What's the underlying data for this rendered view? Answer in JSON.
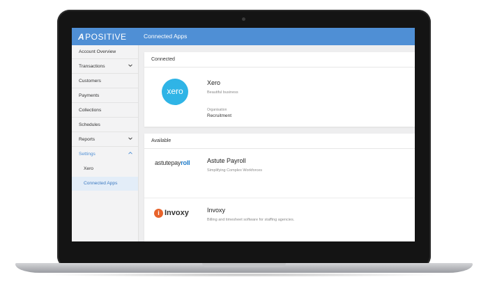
{
  "app": {
    "logo_text": "POSITIVE",
    "logo_mark": "A",
    "page_title": "Connected Apps"
  },
  "sidebar": {
    "items": [
      {
        "label": "Account Overview",
        "chevron": ""
      },
      {
        "label": "Transactions",
        "chevron": "chevron-down-icon"
      },
      {
        "label": "Customers",
        "chevron": ""
      },
      {
        "label": "Payments",
        "chevron": ""
      },
      {
        "label": "Collections",
        "chevron": ""
      },
      {
        "label": "Schedules",
        "chevron": ""
      },
      {
        "label": "Reports",
        "chevron": "chevron-down-icon"
      },
      {
        "label": "Settings",
        "chevron": "chevron-up-icon"
      },
      {
        "label": "Xero",
        "chevron": ""
      },
      {
        "label": "Connected Apps",
        "chevron": ""
      }
    ]
  },
  "connected": {
    "header": "Connected",
    "apps": [
      {
        "name": "Xero",
        "logo_text": "xero",
        "description": "Beautiful business",
        "organisation_label": "Organisation",
        "organisation_value": "Recruitment"
      }
    ]
  },
  "available": {
    "header": "Available",
    "apps": [
      {
        "name": "Astute Payroll",
        "logo_text_a": "astutepay",
        "logo_text_b": "roll",
        "description": "Simplifying Complex Workforces"
      },
      {
        "name": "Invoxy",
        "logo_mark": "i",
        "logo_text": "Invoxy",
        "description": "Billing and timesheet software for staffing agencies."
      }
    ]
  },
  "colors": {
    "brand": "#4f8fd5",
    "xero": "#2fb4e6",
    "invoxy": "#e8632b"
  }
}
